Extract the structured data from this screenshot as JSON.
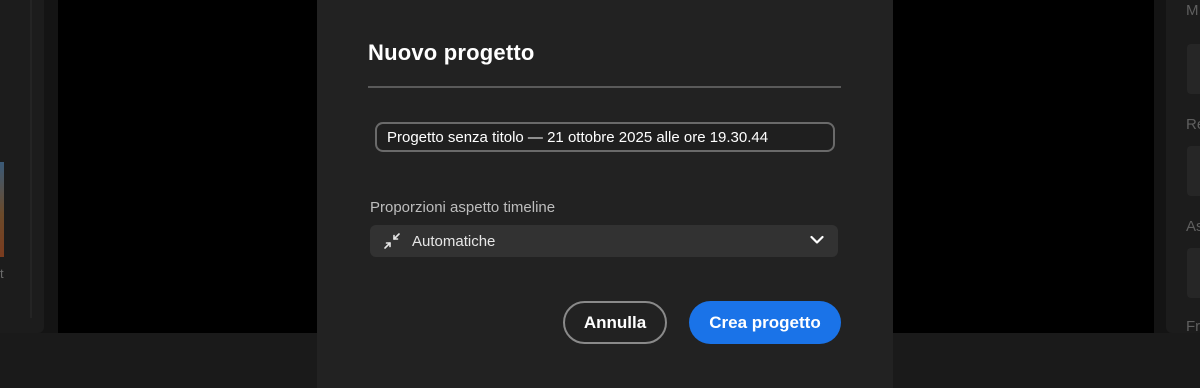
{
  "background": {
    "right_panel_labels": [
      "M",
      "Re",
      "As",
      "Fr"
    ],
    "left_panel_fragment": "t"
  },
  "dialog": {
    "title": "Nuovo progetto",
    "name_input": {
      "value": "Progetto senza titolo — 21 ottobre 2025 alle ore 19.30.44"
    },
    "aspect_label": "Proporzioni aspetto timeline",
    "aspect_select": {
      "selected": "Automatiche",
      "icon": "shrink-arrows-icon"
    },
    "cancel_label": "Annulla",
    "create_label": "Crea progetto"
  },
  "colors": {
    "accent": "#1a73e8",
    "dialog_bg": "#222222",
    "app_bg": "#141414"
  }
}
